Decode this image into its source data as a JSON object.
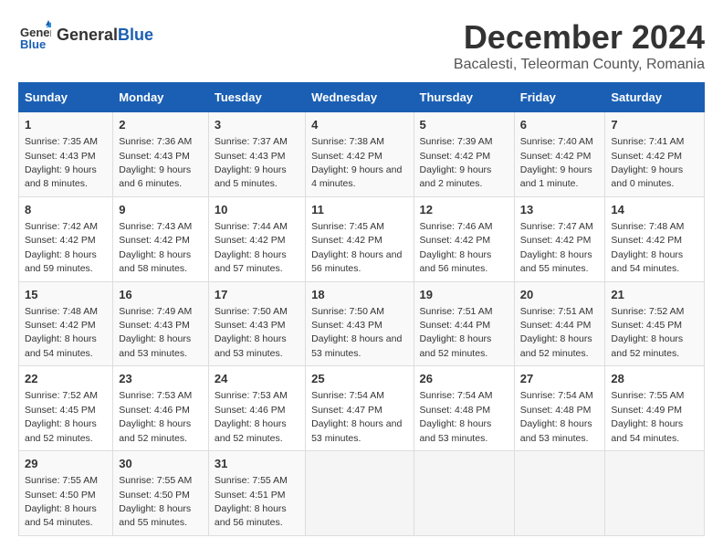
{
  "header": {
    "logo_general": "General",
    "logo_blue": "Blue",
    "title": "December 2024",
    "subtitle": "Bacalesti, Teleorman County, Romania"
  },
  "columns": [
    "Sunday",
    "Monday",
    "Tuesday",
    "Wednesday",
    "Thursday",
    "Friday",
    "Saturday"
  ],
  "weeks": [
    [
      {
        "day": "1",
        "sunrise": "7:35 AM",
        "sunset": "4:43 PM",
        "daylight": "9 hours and 8 minutes."
      },
      {
        "day": "2",
        "sunrise": "7:36 AM",
        "sunset": "4:43 PM",
        "daylight": "9 hours and 6 minutes."
      },
      {
        "day": "3",
        "sunrise": "7:37 AM",
        "sunset": "4:43 PM",
        "daylight": "9 hours and 5 minutes."
      },
      {
        "day": "4",
        "sunrise": "7:38 AM",
        "sunset": "4:42 PM",
        "daylight": "9 hours and 4 minutes."
      },
      {
        "day": "5",
        "sunrise": "7:39 AM",
        "sunset": "4:42 PM",
        "daylight": "9 hours and 2 minutes."
      },
      {
        "day": "6",
        "sunrise": "7:40 AM",
        "sunset": "4:42 PM",
        "daylight": "9 hours and 1 minute."
      },
      {
        "day": "7",
        "sunrise": "7:41 AM",
        "sunset": "4:42 PM",
        "daylight": "9 hours and 0 minutes."
      }
    ],
    [
      {
        "day": "8",
        "sunrise": "7:42 AM",
        "sunset": "4:42 PM",
        "daylight": "8 hours and 59 minutes."
      },
      {
        "day": "9",
        "sunrise": "7:43 AM",
        "sunset": "4:42 PM",
        "daylight": "8 hours and 58 minutes."
      },
      {
        "day": "10",
        "sunrise": "7:44 AM",
        "sunset": "4:42 PM",
        "daylight": "8 hours and 57 minutes."
      },
      {
        "day": "11",
        "sunrise": "7:45 AM",
        "sunset": "4:42 PM",
        "daylight": "8 hours and 56 minutes."
      },
      {
        "day": "12",
        "sunrise": "7:46 AM",
        "sunset": "4:42 PM",
        "daylight": "8 hours and 56 minutes."
      },
      {
        "day": "13",
        "sunrise": "7:47 AM",
        "sunset": "4:42 PM",
        "daylight": "8 hours and 55 minutes."
      },
      {
        "day": "14",
        "sunrise": "7:48 AM",
        "sunset": "4:42 PM",
        "daylight": "8 hours and 54 minutes."
      }
    ],
    [
      {
        "day": "15",
        "sunrise": "7:48 AM",
        "sunset": "4:42 PM",
        "daylight": "8 hours and 54 minutes."
      },
      {
        "day": "16",
        "sunrise": "7:49 AM",
        "sunset": "4:43 PM",
        "daylight": "8 hours and 53 minutes."
      },
      {
        "day": "17",
        "sunrise": "7:50 AM",
        "sunset": "4:43 PM",
        "daylight": "8 hours and 53 minutes."
      },
      {
        "day": "18",
        "sunrise": "7:50 AM",
        "sunset": "4:43 PM",
        "daylight": "8 hours and 53 minutes."
      },
      {
        "day": "19",
        "sunrise": "7:51 AM",
        "sunset": "4:44 PM",
        "daylight": "8 hours and 52 minutes."
      },
      {
        "day": "20",
        "sunrise": "7:51 AM",
        "sunset": "4:44 PM",
        "daylight": "8 hours and 52 minutes."
      },
      {
        "day": "21",
        "sunrise": "7:52 AM",
        "sunset": "4:45 PM",
        "daylight": "8 hours and 52 minutes."
      }
    ],
    [
      {
        "day": "22",
        "sunrise": "7:52 AM",
        "sunset": "4:45 PM",
        "daylight": "8 hours and 52 minutes."
      },
      {
        "day": "23",
        "sunrise": "7:53 AM",
        "sunset": "4:46 PM",
        "daylight": "8 hours and 52 minutes."
      },
      {
        "day": "24",
        "sunrise": "7:53 AM",
        "sunset": "4:46 PM",
        "daylight": "8 hours and 52 minutes."
      },
      {
        "day": "25",
        "sunrise": "7:54 AM",
        "sunset": "4:47 PM",
        "daylight": "8 hours and 53 minutes."
      },
      {
        "day": "26",
        "sunrise": "7:54 AM",
        "sunset": "4:48 PM",
        "daylight": "8 hours and 53 minutes."
      },
      {
        "day": "27",
        "sunrise": "7:54 AM",
        "sunset": "4:48 PM",
        "daylight": "8 hours and 53 minutes."
      },
      {
        "day": "28",
        "sunrise": "7:55 AM",
        "sunset": "4:49 PM",
        "daylight": "8 hours and 54 minutes."
      }
    ],
    [
      {
        "day": "29",
        "sunrise": "7:55 AM",
        "sunset": "4:50 PM",
        "daylight": "8 hours and 54 minutes."
      },
      {
        "day": "30",
        "sunrise": "7:55 AM",
        "sunset": "4:50 PM",
        "daylight": "8 hours and 55 minutes."
      },
      {
        "day": "31",
        "sunrise": "7:55 AM",
        "sunset": "4:51 PM",
        "daylight": "8 hours and 56 minutes."
      },
      null,
      null,
      null,
      null
    ]
  ]
}
